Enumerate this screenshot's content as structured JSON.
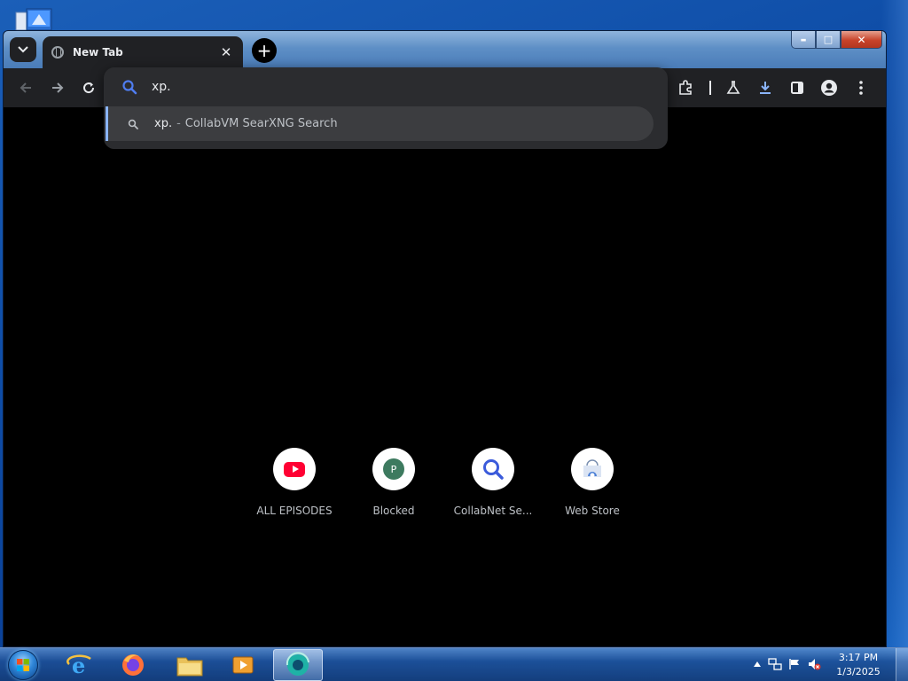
{
  "browser": {
    "tab": {
      "title": "New Tab",
      "close_glyph": "✕"
    },
    "new_tab_glyph": "+",
    "caption": {
      "minimize": "▬",
      "maximize": "□",
      "close": "✕"
    },
    "omnibox": {
      "value": "xp.",
      "suggestion": {
        "query": "xp.",
        "separator": "-",
        "description": "CollabVM SearXNG Search"
      }
    }
  },
  "shortcuts": [
    {
      "label": "ALL EPISODES",
      "icon": "youtube-icon"
    },
    {
      "label": "Blocked",
      "icon": "p-letter-icon",
      "letter": "P"
    },
    {
      "label": "CollabNet Se...",
      "icon": "magnifier-icon"
    },
    {
      "label": "Web Store",
      "icon": "web-store-icon"
    }
  ],
  "taskbar": {
    "apps": [
      "internet-explorer-icon",
      "firefox-icon",
      "file-explorer-icon",
      "media-player-icon",
      "browser-icon"
    ],
    "clock": {
      "time": "3:17 PM",
      "date": "1/3/2025"
    }
  },
  "colors": {
    "accent_blue": "#8ab4f8",
    "toolbar": "#202124",
    "page_bg": "#000000"
  }
}
